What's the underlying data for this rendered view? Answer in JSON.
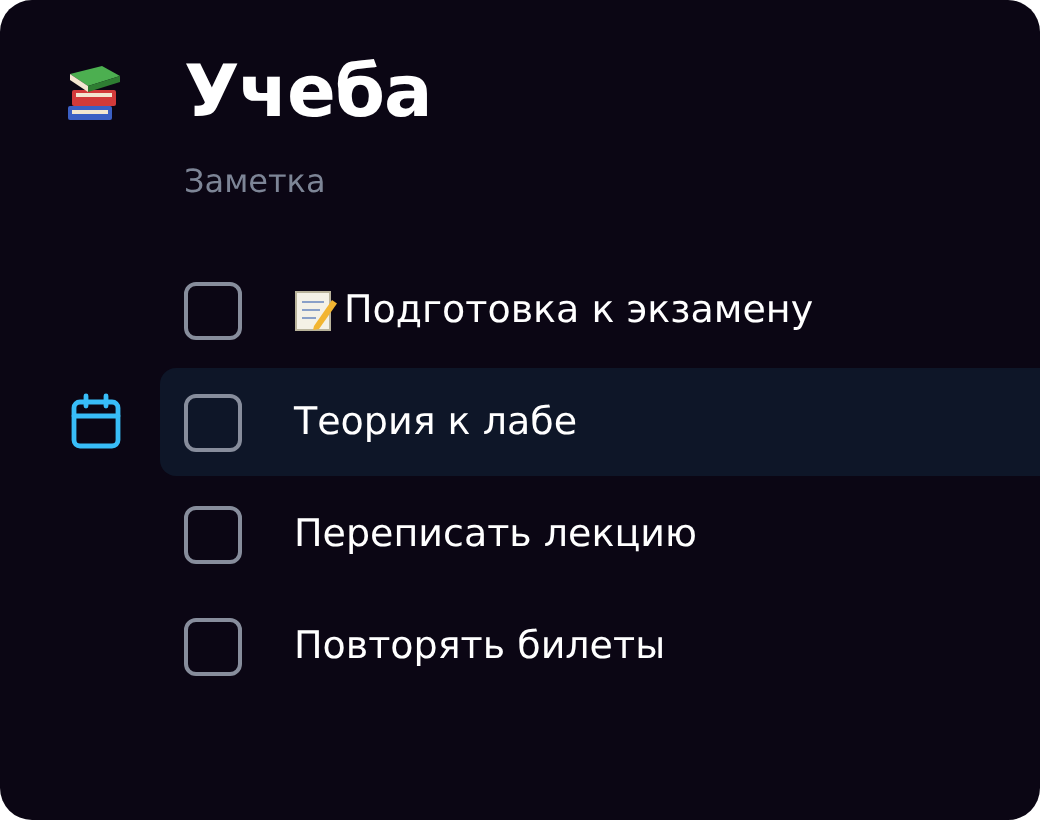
{
  "page": {
    "title": "Учеба",
    "subtitle": "Заметка"
  },
  "tasks": [
    {
      "label": "Подготовка к экзамену",
      "kind": "memo",
      "checked": false,
      "selected": false
    },
    {
      "label": "Теория к лабе",
      "kind": "plain",
      "checked": false,
      "selected": true
    },
    {
      "label": "Переписать лекцию",
      "kind": "plain",
      "checked": false,
      "selected": false
    },
    {
      "label": "Повторять билеты",
      "kind": "plain",
      "checked": false,
      "selected": false
    }
  ]
}
